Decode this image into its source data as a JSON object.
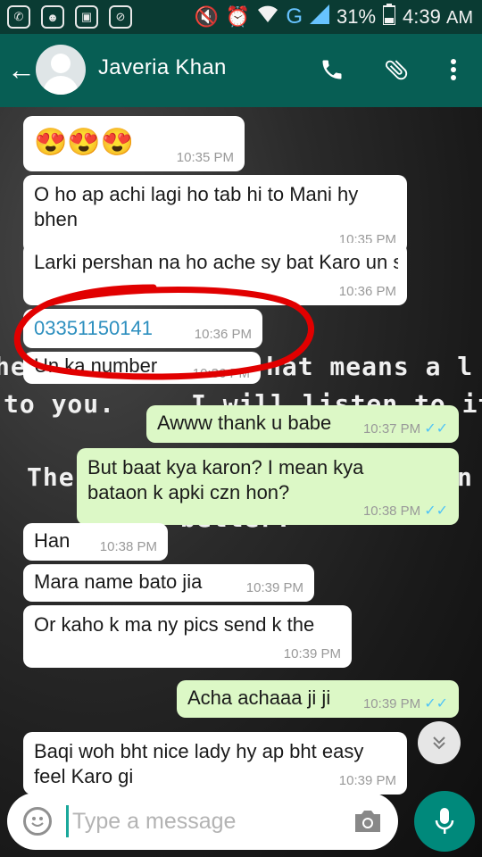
{
  "status_bar": {
    "battery": "31%",
    "time": "4:39",
    "am_pm": "AM",
    "network": "G",
    "icons": [
      "whatsapp-icon",
      "game-icon",
      "image-icon",
      "blocked-icon",
      "mute-icon",
      "alarm-icon",
      "wifi-icon",
      "signal-icon",
      "battery-icon"
    ]
  },
  "header": {
    "contact_name": "Javeria Khan",
    "icons": [
      "back-arrow-icon",
      "avatar",
      "phone-icon",
      "attach-icon",
      "overflow-menu-icon"
    ]
  },
  "wallpaper_quote": [
    "he",
    "hat means a l",
    "to you.",
    "I will listen to it.",
    "The",
    "n",
    "better."
  ],
  "messages": [
    {
      "dir": "in",
      "text": "😍😍😍",
      "time": "10:35 PM"
    },
    {
      "dir": "in",
      "text": "O ho ap achi lagi ho tab hi to Mani hy bhen",
      "time": "10:35 PM"
    },
    {
      "dir": "in",
      "text": "Larki pershan na ho ache sy bat Karo un sy",
      "time": "10:36 PM"
    },
    {
      "dir": "in",
      "text": "03351150141",
      "time": "10:36 PM",
      "is_link": true
    },
    {
      "dir": "in",
      "text": "Un ka number",
      "time": "10:36 PM"
    },
    {
      "dir": "out",
      "text": "Awww thank u babe",
      "time": "10:37 PM",
      "ticks": "✓✓"
    },
    {
      "dir": "out",
      "text": "But baat kya karon?  I mean kya bataon k apki czn hon?",
      "time": "10:38 PM",
      "ticks": "✓✓"
    },
    {
      "dir": "in",
      "text": "Han",
      "time": "10:38 PM"
    },
    {
      "dir": "in",
      "text": "Mara name bato jia",
      "time": "10:39 PM"
    },
    {
      "dir": "in",
      "text": "Or kaho k ma ny pics send k the",
      "time": "10:39 PM"
    },
    {
      "dir": "out",
      "text": "Acha achaaa ji ji",
      "time": "10:39 PM",
      "ticks": "✓✓"
    },
    {
      "dir": "in",
      "text": "Baqi woh bht nice lady hy ap bht easy feel Karo gi",
      "time": "10:39 PM"
    }
  ],
  "composer": {
    "placeholder": "Type a message",
    "icons": [
      "emoji-icon",
      "camera-icon",
      "mic-icon",
      "scroll-down-icon"
    ]
  },
  "colors": {
    "header": "#075e54",
    "status_bar": "#0a3b33",
    "outgoing_bubble": "#dcf8c6",
    "incoming_bubble": "#ffffff",
    "mic_button": "#00897b",
    "annotation_circle": "#e10000"
  }
}
